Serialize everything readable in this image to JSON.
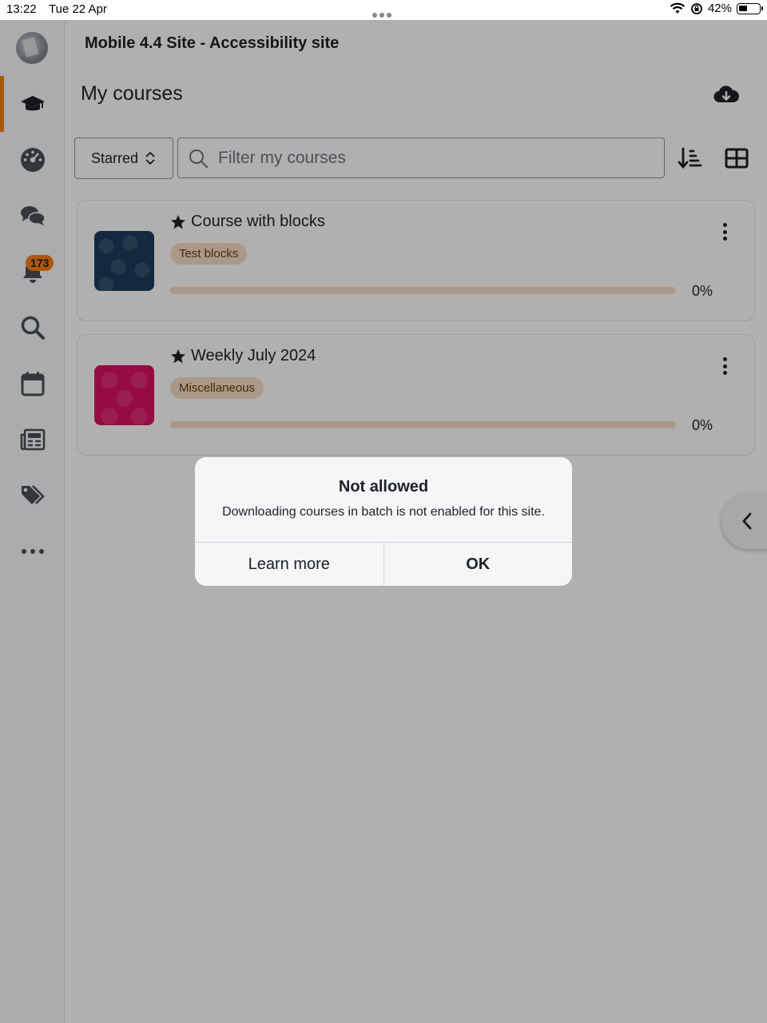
{
  "status_bar": {
    "time": "13:22",
    "date": "Tue 22 Apr",
    "battery": "42%"
  },
  "sidebar": {
    "items": [
      {
        "name": "my-courses",
        "icon": "graduation-cap-icon",
        "active": true
      },
      {
        "name": "dashboard",
        "icon": "dashboard-gauge-icon"
      },
      {
        "name": "messages",
        "icon": "chat-bubbles-icon"
      },
      {
        "name": "notifications",
        "icon": "bell-icon",
        "badge": "173"
      },
      {
        "name": "search",
        "icon": "search-icon"
      },
      {
        "name": "calendar",
        "icon": "calendar-icon"
      },
      {
        "name": "news",
        "icon": "newspaper-icon"
      },
      {
        "name": "tags",
        "icon": "tags-icon"
      },
      {
        "name": "more",
        "icon": "more-dots-icon"
      }
    ],
    "accent": "#f98012"
  },
  "header": {
    "site_title": "Mobile 4.4 Site - Accessibility site",
    "page_title": "My courses"
  },
  "filters": {
    "selected": "Starred",
    "search_placeholder": "Filter my courses"
  },
  "courses": [
    {
      "title": "Course with blocks",
      "category": "Test blocks",
      "progress": 0,
      "progress_label": "0%",
      "starred": true,
      "color": "#1c3d5a"
    },
    {
      "title": "Weekly July 2024",
      "category": "Miscellaneous",
      "progress": 0,
      "progress_label": "0%",
      "starred": true,
      "color": "#d9115f"
    }
  ],
  "dialog": {
    "title": "Not allowed",
    "message": "Downloading courses in batch is not enabled for this site.",
    "buttons": {
      "secondary": "Learn more",
      "primary": "OK"
    }
  }
}
